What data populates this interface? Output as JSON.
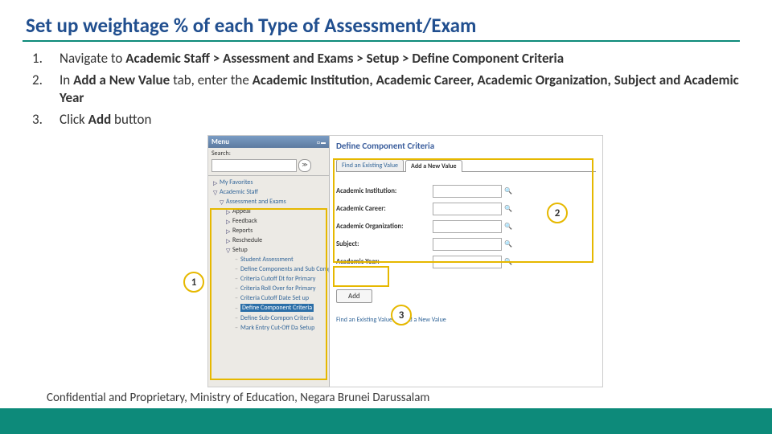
{
  "title": "Set up weightage % of each Type of Assessment/Exam",
  "steps": [
    {
      "num": "1.",
      "html": "Navigate to <b>Academic Staff > Assessment and Exams > Setup > Define Component Criteria</b>"
    },
    {
      "num": "2.",
      "html": "In <b>Add a New Value</b> tab, enter the <b>Academic Institution, Academic Career, Academic Organization, Subject and Academic Year</b>"
    },
    {
      "num": "3.",
      "html": "Click <b>Add</b> button"
    }
  ],
  "menu": {
    "header": "Menu",
    "search_label": "Search:",
    "favorites": "My Favorites",
    "top": "Academic Staff",
    "sub": "Assessment and Exams",
    "children": [
      "Appeal",
      "Feedback",
      "Reports",
      "Reschedule",
      "Setup"
    ],
    "setup_children": [
      "Student Assessment",
      "Define Components and Sub Comp",
      "Criteria Cutoff Dt for Primary",
      "Criteria Roll Over for Primary",
      "Criteria Cutoff Date Set up",
      "Define Component Criteria",
      "Define Sub-Compon Criteria",
      "Mark Entry Cut-Off Da Setup"
    ],
    "selected": "Define Component Criteria"
  },
  "page": {
    "heading": "Define Component Criteria",
    "tab_find": "Find an Existing Value",
    "tab_add": "Add a New Value",
    "fields": [
      "Academic Institution:",
      "Academic Career:",
      "Academic Organization:",
      "Subject:",
      "Academic Year:"
    ],
    "add_button": "Add",
    "bottom_find": "Find an Existing Value",
    "bottom_add": "Add a New Value"
  },
  "callouts": {
    "c1": "1",
    "c2": "2",
    "c3": "3"
  },
  "footer": "Confidential and Proprietary, Ministry of Education, Negara Brunei Darussalam"
}
